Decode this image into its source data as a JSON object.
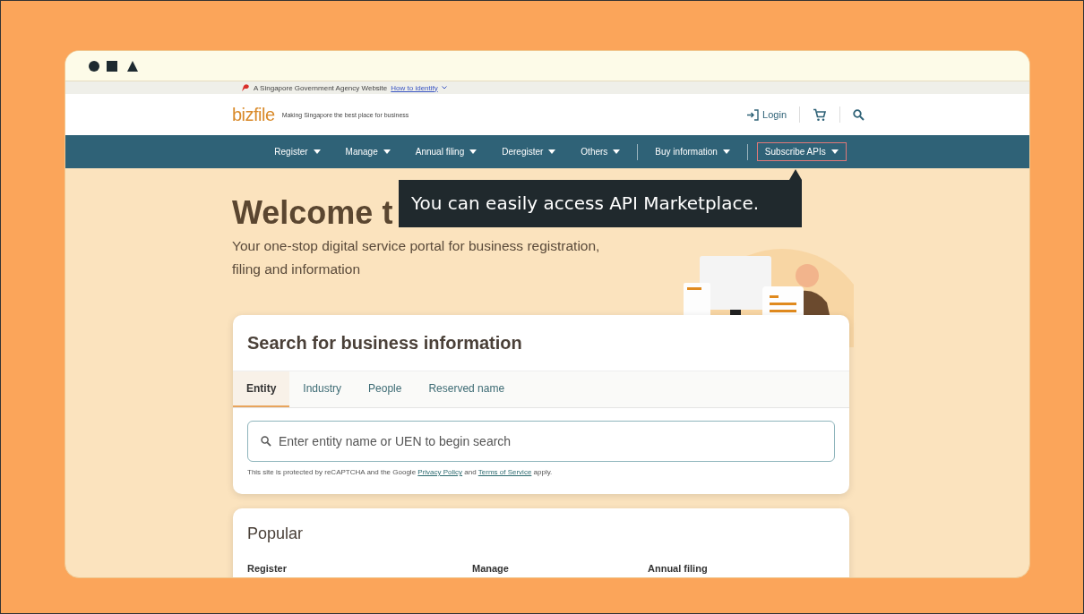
{
  "gov_banner": {
    "text": "A Singapore Government Agency Website",
    "link": "How to identify"
  },
  "header": {
    "logo": "bizfile",
    "tagline": "Making Singapore the best place for business",
    "login": "Login"
  },
  "nav": {
    "groups": [
      [
        {
          "label": "Register",
          "highlighted": false
        },
        {
          "label": "Manage",
          "highlighted": false
        },
        {
          "label": "Annual filing",
          "highlighted": false
        },
        {
          "label": "Deregister",
          "highlighted": false
        },
        {
          "label": "Others",
          "highlighted": false
        }
      ],
      [
        {
          "label": "Buy information",
          "highlighted": false
        }
      ],
      [
        {
          "label": "Subscribe APIs",
          "highlighted": true
        }
      ]
    ]
  },
  "hero": {
    "heading": "Welcome t",
    "subtitle": "Your one-stop digital service portal for business registration, filing and information"
  },
  "tooltip": {
    "text": "You can easily access API Marketplace."
  },
  "search_card": {
    "title": "Search for business information",
    "tabs": [
      {
        "label": "Entity",
        "selected": true
      },
      {
        "label": "Industry",
        "selected": false
      },
      {
        "label": "People",
        "selected": false
      },
      {
        "label": "Reserved name",
        "selected": false
      }
    ],
    "search": {
      "placeholder": "Enter entity name or UEN to begin search"
    },
    "notice": {
      "before": "This site is protected by reCAPTCHA and the Google",
      "link_1": "Privacy Policy",
      "middle": "and",
      "link_2": "Terms of Service",
      "after": "apply."
    }
  },
  "popular": {
    "title": "Popular",
    "columns": [
      "Register",
      "Manage",
      "Annual filing"
    ]
  }
}
